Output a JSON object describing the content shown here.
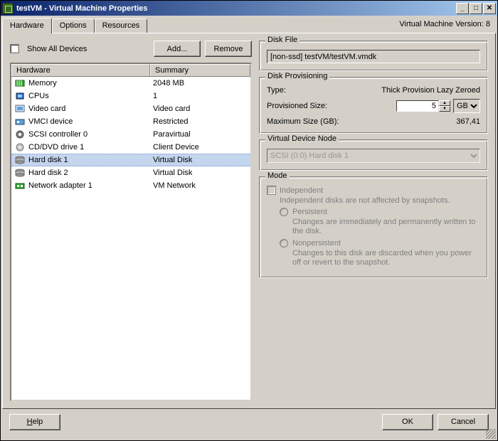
{
  "window": {
    "title": "testVM - Virtual Machine Properties",
    "version_label": "Virtual Machine Version: 8"
  },
  "tabs": [
    {
      "label": "Hardware",
      "active": true
    },
    {
      "label": "Options",
      "active": false
    },
    {
      "label": "Resources",
      "active": false
    }
  ],
  "toolbar": {
    "show_all_label": "Show All Devices",
    "show_all_checked": false,
    "add_label": "Add...",
    "remove_label": "Remove"
  },
  "hardware_list": {
    "col_hardware": "Hardware",
    "col_summary": "Summary",
    "items": [
      {
        "icon": "memory-icon",
        "label": "Memory",
        "summary": "2048 MB",
        "selected": false
      },
      {
        "icon": "cpu-icon",
        "label": "CPUs",
        "summary": "1",
        "selected": false
      },
      {
        "icon": "video-icon",
        "label": "Video card",
        "summary": "Video card",
        "selected": false
      },
      {
        "icon": "vmci-icon",
        "label": "VMCI device",
        "summary": "Restricted",
        "selected": false
      },
      {
        "icon": "scsi-icon",
        "label": "SCSI controller 0",
        "summary": "Paravirtual",
        "selected": false
      },
      {
        "icon": "cd-icon",
        "label": "CD/DVD drive 1",
        "summary": "Client Device",
        "selected": false
      },
      {
        "icon": "disk-icon",
        "label": "Hard disk 1",
        "summary": "Virtual Disk",
        "selected": true
      },
      {
        "icon": "disk-icon",
        "label": "Hard disk 2",
        "summary": "Virtual Disk",
        "selected": false
      },
      {
        "icon": "nic-icon",
        "label": "Network adapter 1",
        "summary": "VM Network",
        "selected": false
      }
    ]
  },
  "disk_file": {
    "legend": "Disk File",
    "value": "[non-ssd] testVM/testVM.vmdk"
  },
  "disk_provisioning": {
    "legend": "Disk Provisioning",
    "type_label": "Type:",
    "type_value": "Thick Provision Lazy Zeroed",
    "size_label": "Provisioned Size:",
    "size_value": "5",
    "size_unit": "GB",
    "max_label": "Maximum Size (GB):",
    "max_value": "367,41"
  },
  "virtual_device_node": {
    "legend": "Virtual Device Node",
    "value": "SCSI (0:0) Hard disk 1"
  },
  "mode": {
    "legend": "Mode",
    "independent_label": "Independent",
    "independent_desc": "Independent disks are not affected by snapshots.",
    "persistent_label": "Persistent",
    "persistent_desc": "Changes are immediately and permanently written to the disk.",
    "nonpersistent_label": "Nonpersistent",
    "nonpersistent_desc": "Changes to this disk are discarded when you power off or revert to the snapshot."
  },
  "footer": {
    "help_label": "Help",
    "ok_label": "OK",
    "cancel_label": "Cancel"
  },
  "icons": {
    "memory-icon": "#2da82d",
    "cpu-icon": "#2d6ad6",
    "video-icon": "#5aa0e0",
    "vmci-icon": "#5aa0e0",
    "scsi-icon": "#808080",
    "cd-icon": "#c5c5c5",
    "disk-icon": "#b0b0b0",
    "nic-icon": "#2da82d"
  }
}
